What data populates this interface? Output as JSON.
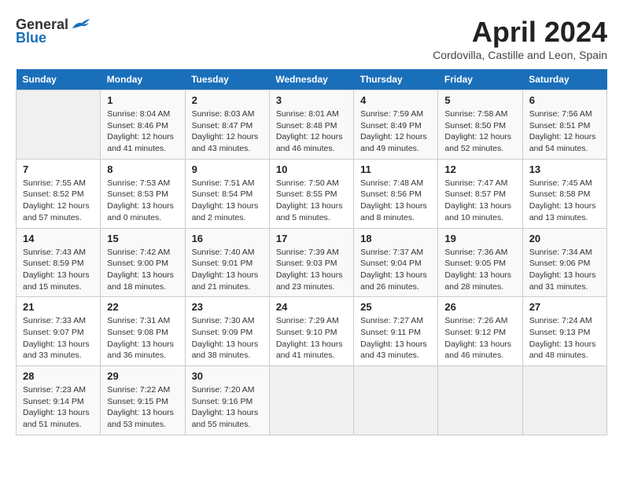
{
  "header": {
    "logo_general": "General",
    "logo_blue": "Blue",
    "title": "April 2024",
    "subtitle": "Cordovilla, Castille and Leon, Spain"
  },
  "weekdays": [
    "Sunday",
    "Monday",
    "Tuesday",
    "Wednesday",
    "Thursday",
    "Friday",
    "Saturday"
  ],
  "weeks": [
    [
      {
        "day": "",
        "sunrise": "",
        "sunset": "",
        "daylight": ""
      },
      {
        "day": "1",
        "sunrise": "Sunrise: 8:04 AM",
        "sunset": "Sunset: 8:46 PM",
        "daylight": "Daylight: 12 hours and 41 minutes."
      },
      {
        "day": "2",
        "sunrise": "Sunrise: 8:03 AM",
        "sunset": "Sunset: 8:47 PM",
        "daylight": "Daylight: 12 hours and 43 minutes."
      },
      {
        "day": "3",
        "sunrise": "Sunrise: 8:01 AM",
        "sunset": "Sunset: 8:48 PM",
        "daylight": "Daylight: 12 hours and 46 minutes."
      },
      {
        "day": "4",
        "sunrise": "Sunrise: 7:59 AM",
        "sunset": "Sunset: 8:49 PM",
        "daylight": "Daylight: 12 hours and 49 minutes."
      },
      {
        "day": "5",
        "sunrise": "Sunrise: 7:58 AM",
        "sunset": "Sunset: 8:50 PM",
        "daylight": "Daylight: 12 hours and 52 minutes."
      },
      {
        "day": "6",
        "sunrise": "Sunrise: 7:56 AM",
        "sunset": "Sunset: 8:51 PM",
        "daylight": "Daylight: 12 hours and 54 minutes."
      }
    ],
    [
      {
        "day": "7",
        "sunrise": "Sunrise: 7:55 AM",
        "sunset": "Sunset: 8:52 PM",
        "daylight": "Daylight: 12 hours and 57 minutes."
      },
      {
        "day": "8",
        "sunrise": "Sunrise: 7:53 AM",
        "sunset": "Sunset: 8:53 PM",
        "daylight": "Daylight: 13 hours and 0 minutes."
      },
      {
        "day": "9",
        "sunrise": "Sunrise: 7:51 AM",
        "sunset": "Sunset: 8:54 PM",
        "daylight": "Daylight: 13 hours and 2 minutes."
      },
      {
        "day": "10",
        "sunrise": "Sunrise: 7:50 AM",
        "sunset": "Sunset: 8:55 PM",
        "daylight": "Daylight: 13 hours and 5 minutes."
      },
      {
        "day": "11",
        "sunrise": "Sunrise: 7:48 AM",
        "sunset": "Sunset: 8:56 PM",
        "daylight": "Daylight: 13 hours and 8 minutes."
      },
      {
        "day": "12",
        "sunrise": "Sunrise: 7:47 AM",
        "sunset": "Sunset: 8:57 PM",
        "daylight": "Daylight: 13 hours and 10 minutes."
      },
      {
        "day": "13",
        "sunrise": "Sunrise: 7:45 AM",
        "sunset": "Sunset: 8:58 PM",
        "daylight": "Daylight: 13 hours and 13 minutes."
      }
    ],
    [
      {
        "day": "14",
        "sunrise": "Sunrise: 7:43 AM",
        "sunset": "Sunset: 8:59 PM",
        "daylight": "Daylight: 13 hours and 15 minutes."
      },
      {
        "day": "15",
        "sunrise": "Sunrise: 7:42 AM",
        "sunset": "Sunset: 9:00 PM",
        "daylight": "Daylight: 13 hours and 18 minutes."
      },
      {
        "day": "16",
        "sunrise": "Sunrise: 7:40 AM",
        "sunset": "Sunset: 9:01 PM",
        "daylight": "Daylight: 13 hours and 21 minutes."
      },
      {
        "day": "17",
        "sunrise": "Sunrise: 7:39 AM",
        "sunset": "Sunset: 9:03 PM",
        "daylight": "Daylight: 13 hours and 23 minutes."
      },
      {
        "day": "18",
        "sunrise": "Sunrise: 7:37 AM",
        "sunset": "Sunset: 9:04 PM",
        "daylight": "Daylight: 13 hours and 26 minutes."
      },
      {
        "day": "19",
        "sunrise": "Sunrise: 7:36 AM",
        "sunset": "Sunset: 9:05 PM",
        "daylight": "Daylight: 13 hours and 28 minutes."
      },
      {
        "day": "20",
        "sunrise": "Sunrise: 7:34 AM",
        "sunset": "Sunset: 9:06 PM",
        "daylight": "Daylight: 13 hours and 31 minutes."
      }
    ],
    [
      {
        "day": "21",
        "sunrise": "Sunrise: 7:33 AM",
        "sunset": "Sunset: 9:07 PM",
        "daylight": "Daylight: 13 hours and 33 minutes."
      },
      {
        "day": "22",
        "sunrise": "Sunrise: 7:31 AM",
        "sunset": "Sunset: 9:08 PM",
        "daylight": "Daylight: 13 hours and 36 minutes."
      },
      {
        "day": "23",
        "sunrise": "Sunrise: 7:30 AM",
        "sunset": "Sunset: 9:09 PM",
        "daylight": "Daylight: 13 hours and 38 minutes."
      },
      {
        "day": "24",
        "sunrise": "Sunrise: 7:29 AM",
        "sunset": "Sunset: 9:10 PM",
        "daylight": "Daylight: 13 hours and 41 minutes."
      },
      {
        "day": "25",
        "sunrise": "Sunrise: 7:27 AM",
        "sunset": "Sunset: 9:11 PM",
        "daylight": "Daylight: 13 hours and 43 minutes."
      },
      {
        "day": "26",
        "sunrise": "Sunrise: 7:26 AM",
        "sunset": "Sunset: 9:12 PM",
        "daylight": "Daylight: 13 hours and 46 minutes."
      },
      {
        "day": "27",
        "sunrise": "Sunrise: 7:24 AM",
        "sunset": "Sunset: 9:13 PM",
        "daylight": "Daylight: 13 hours and 48 minutes."
      }
    ],
    [
      {
        "day": "28",
        "sunrise": "Sunrise: 7:23 AM",
        "sunset": "Sunset: 9:14 PM",
        "daylight": "Daylight: 13 hours and 51 minutes."
      },
      {
        "day": "29",
        "sunrise": "Sunrise: 7:22 AM",
        "sunset": "Sunset: 9:15 PM",
        "daylight": "Daylight: 13 hours and 53 minutes."
      },
      {
        "day": "30",
        "sunrise": "Sunrise: 7:20 AM",
        "sunset": "Sunset: 9:16 PM",
        "daylight": "Daylight: 13 hours and 55 minutes."
      },
      {
        "day": "",
        "sunrise": "",
        "sunset": "",
        "daylight": ""
      },
      {
        "day": "",
        "sunrise": "",
        "sunset": "",
        "daylight": ""
      },
      {
        "day": "",
        "sunrise": "",
        "sunset": "",
        "daylight": ""
      },
      {
        "day": "",
        "sunrise": "",
        "sunset": "",
        "daylight": ""
      }
    ]
  ]
}
